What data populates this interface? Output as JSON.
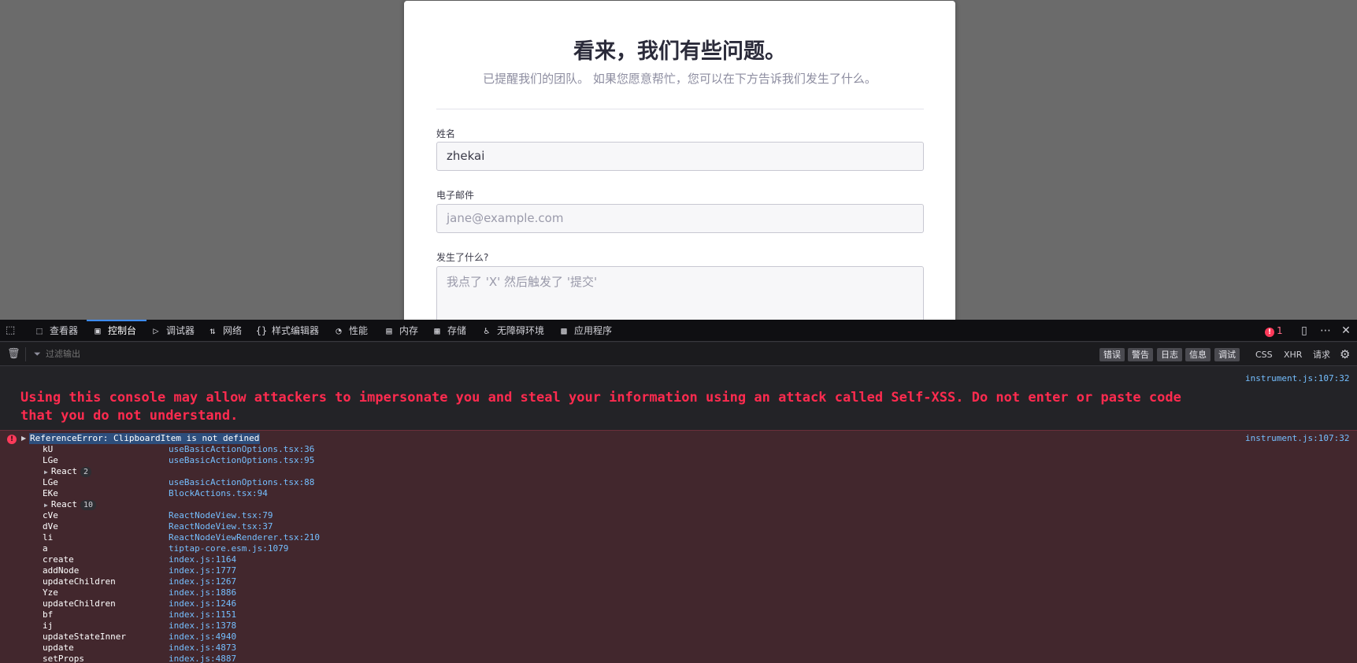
{
  "dialog": {
    "title": "看来，我们有些问题。",
    "subtitle": "已提醒我们的团队。 如果您愿意帮忙，您可以在下方告诉我们发生了什么。",
    "fields": {
      "name_label": "姓名",
      "name_value": "zhekai",
      "email_label": "电子邮件",
      "email_placeholder": "jane@example.com",
      "what_label": "发生了什么?",
      "what_placeholder": "我点了 'X' 然后触发了 '提交'"
    }
  },
  "devtools": {
    "tabs": [
      {
        "label": "查看器",
        "icon": "inspector-icon"
      },
      {
        "label": "控制台",
        "icon": "console-icon",
        "active": true
      },
      {
        "label": "调试器",
        "icon": "debugger-icon"
      },
      {
        "label": "网络",
        "icon": "network-icon"
      },
      {
        "label": "样式编辑器",
        "icon": "style-editor-icon"
      },
      {
        "label": "性能",
        "icon": "performance-icon"
      },
      {
        "label": "内存",
        "icon": "memory-icon"
      },
      {
        "label": "存储",
        "icon": "storage-icon"
      },
      {
        "label": "无障碍环境",
        "icon": "accessibility-icon"
      },
      {
        "label": "应用程序",
        "icon": "application-icon"
      }
    ],
    "error_count": "1",
    "filter": {
      "placeholder": "过滤输出",
      "levels": [
        "错误",
        "警告",
        "日志",
        "信息",
        "调试"
      ],
      "requests": [
        "CSS",
        "XHR",
        "请求"
      ]
    },
    "console": {
      "warning_source": "instrument.js:107:32",
      "warning_text": "Using this console may allow attackers to impersonate you and steal your information using an attack called Self-XSS. Do not enter or paste code that you do not understand.",
      "error_source": "instrument.js:107:32",
      "error_message": "ReferenceError: ClipboardItem is not defined",
      "stack": [
        {
          "fn": "kU",
          "loc": "useBasicActionOptions.tsx:36"
        },
        {
          "fn": "LGe",
          "loc": "useBasicActionOptions.tsx:95"
        },
        {
          "group": "React",
          "count": "2"
        },
        {
          "fn": "LGe",
          "loc": "useBasicActionOptions.tsx:88"
        },
        {
          "fn": "EKe",
          "loc": "BlockActions.tsx:94"
        },
        {
          "group": "React",
          "count": "10"
        },
        {
          "fn": "cVe",
          "loc": "ReactNodeView.tsx:79"
        },
        {
          "fn": "dVe",
          "loc": "ReactNodeView.tsx:37"
        },
        {
          "fn": "li",
          "loc": "ReactNodeViewRenderer.tsx:210"
        },
        {
          "fn": "a",
          "loc": "tiptap-core.esm.js:1079"
        },
        {
          "fn": "create",
          "loc": "index.js:1164"
        },
        {
          "fn": "addNode",
          "loc": "index.js:1777"
        },
        {
          "fn": "updateChildren",
          "loc": "index.js:1267"
        },
        {
          "fn": "Yze",
          "loc": "index.js:1886"
        },
        {
          "fn": "updateChildren",
          "loc": "index.js:1246"
        },
        {
          "fn": "bf",
          "loc": "index.js:1151"
        },
        {
          "fn": "ij",
          "loc": "index.js:1378"
        },
        {
          "fn": "updateStateInner",
          "loc": "index.js:4940"
        },
        {
          "fn": "update",
          "loc": "index.js:4873"
        },
        {
          "fn": "setProps",
          "loc": "index.js:4887"
        }
      ]
    }
  }
}
